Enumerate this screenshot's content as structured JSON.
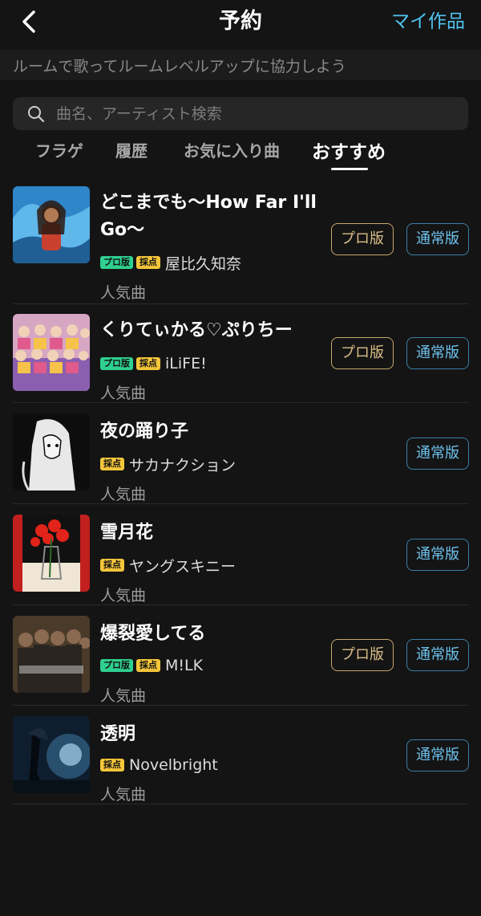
{
  "header": {
    "title": "予約",
    "right_link": "マイ作品"
  },
  "subbar": {
    "text": "ルームで歌ってルームレベルアップに協力しよう"
  },
  "search": {
    "placeholder": "曲名、アーティスト検索"
  },
  "tabs": [
    {
      "label": "フラゲ"
    },
    {
      "label": "履歴"
    },
    {
      "label": "お気に入り曲"
    },
    {
      "label": "おすすめ",
      "active": true
    }
  ],
  "badges": {
    "pro": "プロ版",
    "score": "採点"
  },
  "buttons": {
    "pro": "プロ版",
    "normal": "通常版"
  },
  "songs": [
    {
      "title": "どこまでも〜How Far I'll Go〜",
      "artist": "屋比久知奈",
      "tag": "人気曲",
      "pro": true
    },
    {
      "title": "くりてぃかる♡ぷりちー",
      "artist": "iLiFE!",
      "tag": "人気曲",
      "pro": true
    },
    {
      "title": "夜の踊り子",
      "artist": "サカナクション",
      "tag": "人気曲",
      "pro": false
    },
    {
      "title": "雪月花",
      "artist": "ヤングスキニー",
      "tag": "人気曲",
      "pro": false
    },
    {
      "title": "爆裂愛してる",
      "artist": "M!LK",
      "tag": "人気曲",
      "pro": true
    },
    {
      "title": "透明",
      "artist": "Novelbright",
      "tag": "人気曲",
      "pro": false
    }
  ]
}
